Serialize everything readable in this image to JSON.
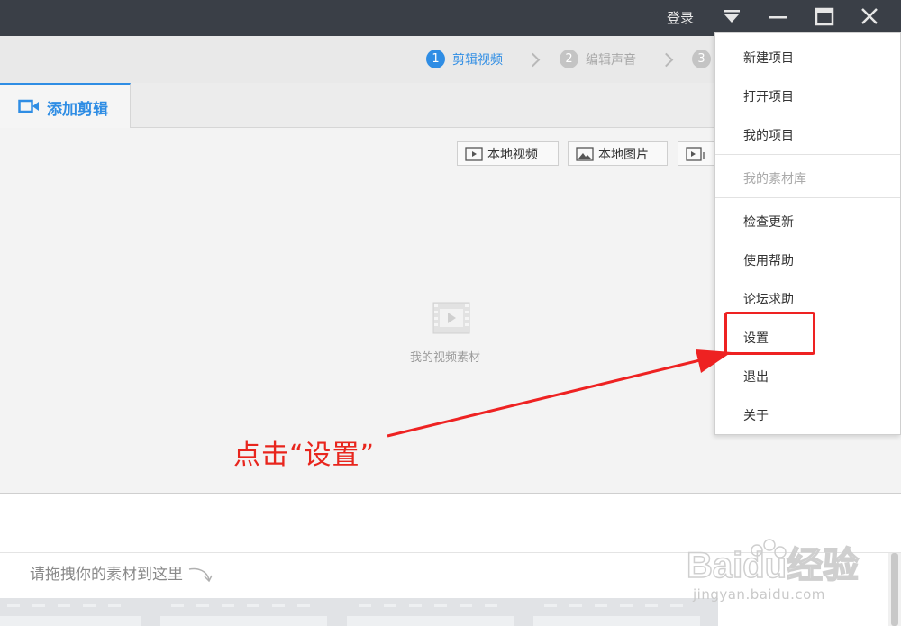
{
  "titlebar": {
    "login": "登录"
  },
  "steps": [
    {
      "num": "1",
      "label": "剪辑视频"
    },
    {
      "num": "2",
      "label": "编辑声音"
    },
    {
      "num": "3",
      "label": ""
    }
  ],
  "tab": {
    "label": "添加剪辑"
  },
  "toolbar": {
    "local_video": "本地视频",
    "local_image": "本地图片"
  },
  "empty_state": {
    "label": "我的视频素材"
  },
  "timeline": {
    "drag_hint": "请拖拽你的素材到这里"
  },
  "menu": {
    "items": [
      "新建项目",
      "打开项目",
      "我的项目",
      "我的素材库",
      "检查更新",
      "使用帮助",
      "论坛求助",
      "设置",
      "退出",
      "关于"
    ]
  },
  "annotation": {
    "text": "点击“设置”"
  },
  "watermark": {
    "logo_text": "Baidu经验",
    "url": "jingyan.baidu.com"
  },
  "colors": {
    "accent": "#2f8de4",
    "annotation": "#e8251d",
    "titlebar": "#3a3f47"
  }
}
